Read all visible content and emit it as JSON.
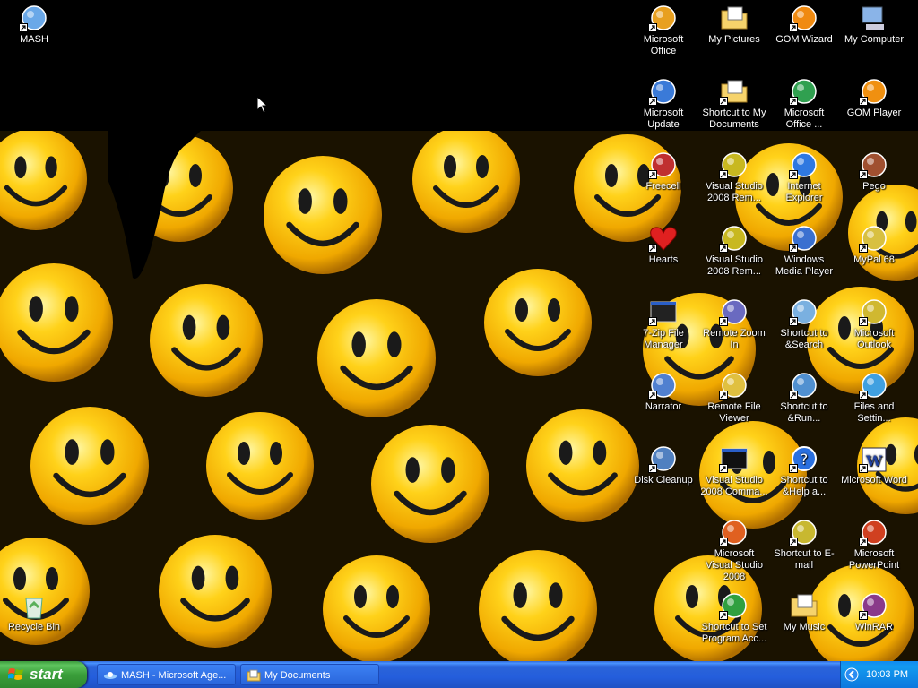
{
  "desktop": {
    "icons": [
      {
        "label": "MASH",
        "icon": "ufo-icon",
        "name": "mash"
      },
      {
        "label": "Microsoft Office",
        "icon": "office-icon",
        "name": "microsoft-office"
      },
      {
        "label": "My Pictures",
        "icon": "pictures-folder-icon",
        "name": "my-pictures"
      },
      {
        "label": "GOM Wizard",
        "icon": "gom-wizard-icon",
        "name": "gom-wizard"
      },
      {
        "label": "My Computer",
        "icon": "computer-icon",
        "name": "my-computer"
      },
      {
        "label": "Microsoft Update",
        "icon": "update-icon",
        "name": "microsoft-update"
      },
      {
        "label": "Shortcut to My Documents",
        "icon": "documents-folder-icon",
        "name": "shortcut-my-documents"
      },
      {
        "label": "Microsoft Office ...",
        "icon": "office-tools-icon",
        "name": "microsoft-office-tools"
      },
      {
        "label": "GOM Player",
        "icon": "gom-player-icon",
        "name": "gom-player"
      },
      {
        "label": "Freecell",
        "icon": "freecell-icon",
        "name": "freecell"
      },
      {
        "label": "Visual Studio 2008 Rem...",
        "icon": "visual-studio-icon",
        "name": "visual-studio-rem-1"
      },
      {
        "label": "Internet Explorer",
        "icon": "internet-explorer-icon",
        "name": "internet-explorer"
      },
      {
        "label": "Pego",
        "icon": "pego-icon",
        "name": "pego"
      },
      {
        "label": "Hearts",
        "icon": "heart-icon",
        "name": "hearts"
      },
      {
        "label": "Visual Studio 2008 Rem...",
        "icon": "visual-studio-icon",
        "name": "visual-studio-rem-2"
      },
      {
        "label": "Windows Media Player",
        "icon": "media-player-icon",
        "name": "windows-media-player"
      },
      {
        "label": "MyPal 68",
        "icon": "mypal-icon",
        "name": "mypal"
      },
      {
        "label": "7-Zip File Manager",
        "icon": "7zip-icon",
        "name": "7zip"
      },
      {
        "label": "Remote Zoom In",
        "icon": "remote-zoom-icon",
        "name": "remote-zoom-in"
      },
      {
        "label": "Shortcut to &Search",
        "icon": "search-icon",
        "name": "shortcut-search"
      },
      {
        "label": "Microsoft Outlook",
        "icon": "outlook-icon",
        "name": "microsoft-outlook"
      },
      {
        "label": "Narrator",
        "icon": "narrator-icon",
        "name": "narrator"
      },
      {
        "label": "Remote File Viewer",
        "icon": "file-viewer-icon",
        "name": "remote-file-viewer"
      },
      {
        "label": "Shortcut to &Run...",
        "icon": "run-icon",
        "name": "shortcut-run"
      },
      {
        "label": "Files and Settin...",
        "icon": "transfer-icon",
        "name": "files-and-settings"
      },
      {
        "label": "Disk Cleanup",
        "icon": "disk-cleanup-icon",
        "name": "disk-cleanup"
      },
      {
        "label": "Visual Studio 2008 Comma...",
        "icon": "command-prompt-icon",
        "name": "vs-command-prompt"
      },
      {
        "label": "Shortcut to &Help a...",
        "icon": "help-icon",
        "name": "shortcut-help"
      },
      {
        "label": "Microsoft Word",
        "icon": "word-icon",
        "name": "microsoft-word"
      },
      {
        "label": "Microsoft Visual Studio 2008",
        "icon": "visual-studio-2008-icon",
        "name": "microsoft-visual-studio-2008"
      },
      {
        "label": "Shortcut to E-mail",
        "icon": "email-icon",
        "name": "shortcut-email"
      },
      {
        "label": "Microsoft PowerPoint",
        "icon": "powerpoint-icon",
        "name": "microsoft-powerpoint"
      },
      {
        "label": "Recycle Bin",
        "icon": "recycle-bin-icon",
        "name": "recycle-bin"
      },
      {
        "label": "Shortcut to Set Program Acc...",
        "icon": "program-access-icon",
        "name": "shortcut-set-program-access"
      },
      {
        "label": "My Music",
        "icon": "music-folder-icon",
        "name": "my-music"
      },
      {
        "label": "WinRAR",
        "icon": "winrar-icon",
        "name": "winrar"
      }
    ]
  },
  "taskbar": {
    "start_label": "start",
    "tasks": [
      {
        "label": "MASH - Microsoft Age...",
        "icon": "agent-icon"
      },
      {
        "label": "My Documents",
        "icon": "folder-icon"
      }
    ],
    "clock": "10:03 PM"
  },
  "colors": {
    "taskbar": "#245edc",
    "start": "#3a9e3a",
    "wallpaper_ball": "#f5b800"
  }
}
